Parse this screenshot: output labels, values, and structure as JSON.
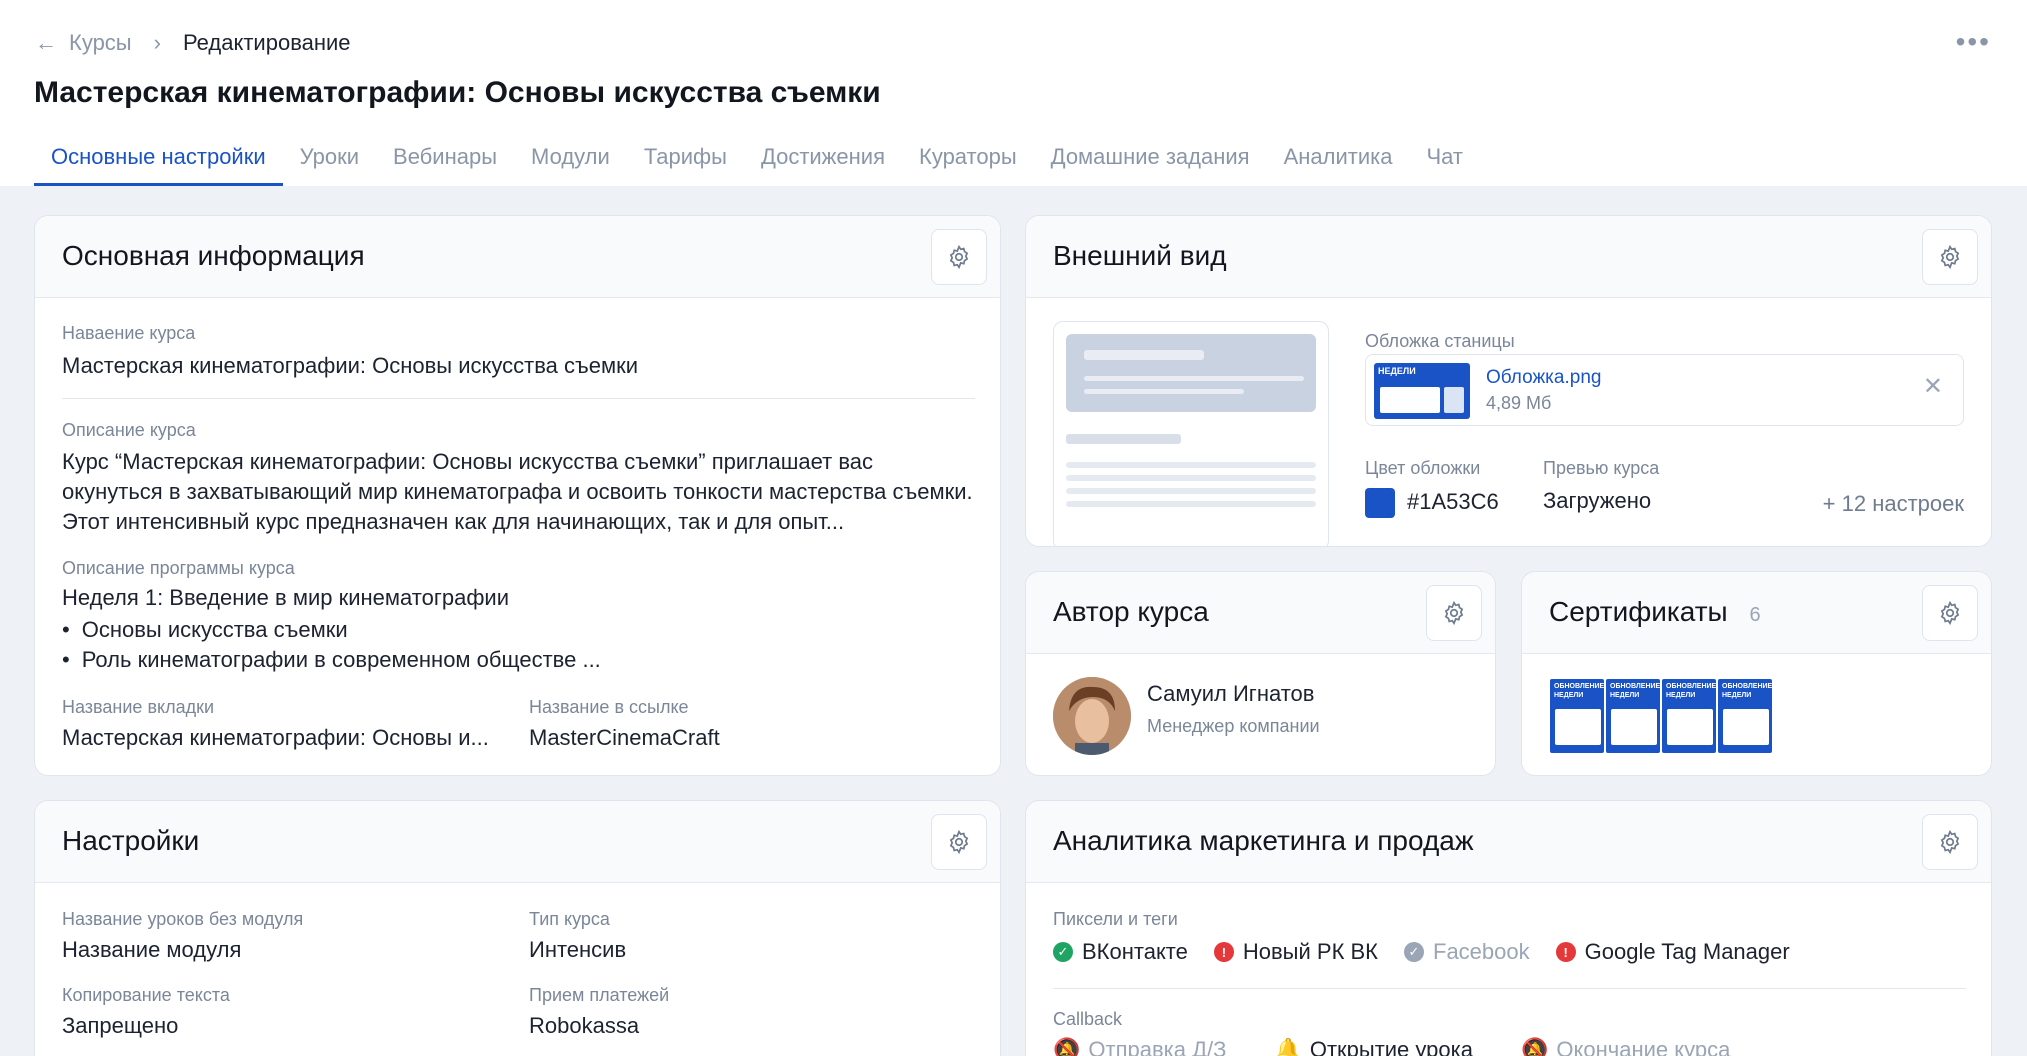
{
  "breadcrumb": {
    "back": "Курсы",
    "current": "Редактирование"
  },
  "page_title": "Мастерская кинематографии: Основы искусства съемки",
  "tabs": [
    "Основные настройки",
    "Уроки",
    "Вебинары",
    "Модули",
    "Тарифы",
    "Достижения",
    "Кураторы",
    "Домашние задания",
    "Аналитика",
    "Чат"
  ],
  "basic": {
    "title": "Основная информация",
    "name_label": "Наваение курса",
    "name_value": "Мастерская кинематографии: Основы искусства съемки",
    "desc_label": "Описание курса",
    "desc_value": "Курс “Мастерская кинематографии: Основы искусства съемки” приглашает вас окунуться в захватывающий мир кинематографа и освоить тонкости мастерства съемки. Этот интенсивный курс предназначен как для начинающих, так и для опыт...",
    "program_label": "Описание программы курса",
    "program_week": "Неделя 1: Введение в мир кинематографии",
    "program_items": [
      "Основы искусства съемки",
      "Роль кинематографии в современном обществе ..."
    ],
    "tab_label": "Название вкладки",
    "tab_value": "Мастерская кинематографии: Основы и...",
    "link_label": "Название в ссылке",
    "link_value": "MasterCinemaCraft"
  },
  "appearance": {
    "title": "Внешний вид",
    "cover_label": "Обложка станицы",
    "file_name": "Обложка.png",
    "file_size": "4,89 Мб",
    "thumb_text": "НЕДЕЛИ",
    "color_label": "Цвет обложки",
    "color_value": "#1A53C6",
    "preview_label": "Превью курса",
    "preview_value": "Загружено",
    "more": "+ 12 настроек"
  },
  "author": {
    "title": "Автор курса",
    "name": "Самуил Игнатов",
    "role": "Менеджер компании"
  },
  "certs": {
    "title": "Сертификаты",
    "count": "6",
    "thumb_text": "ОБНОВЛЕНИЕ НЕДЕЛИ"
  },
  "settings": {
    "title": "Настройки",
    "lessons_label": "Название уроков без модуля",
    "lessons_value": "Название модуля",
    "type_label": "Тип курса",
    "type_value": "Интенсив",
    "copy_label": "Копирование текста",
    "copy_value": "Запрещено",
    "pay_label": "Прием платежей",
    "pay_value": "Robokassa"
  },
  "marketing": {
    "title": "Аналитика маркетинга и продаж",
    "pixels_label": "Пиксели и теги",
    "pixels": [
      {
        "name": "ВКонтакте",
        "status": "ok"
      },
      {
        "name": "Новый РК ВК",
        "status": "error"
      },
      {
        "name": "Facebook",
        "status": "off"
      },
      {
        "name": "Google Tag Manager",
        "status": "error"
      }
    ],
    "callback_label": "Callback",
    "callbacks": [
      {
        "name": "Отправка Д/З",
        "active": false
      },
      {
        "name": "Открытие урока",
        "active": true
      },
      {
        "name": "Окончание курса",
        "active": false
      }
    ]
  },
  "colors": {
    "accent": "#1A53C6",
    "ok": "#1fa463",
    "error": "#e5383b",
    "off": "#9aa5b5"
  }
}
